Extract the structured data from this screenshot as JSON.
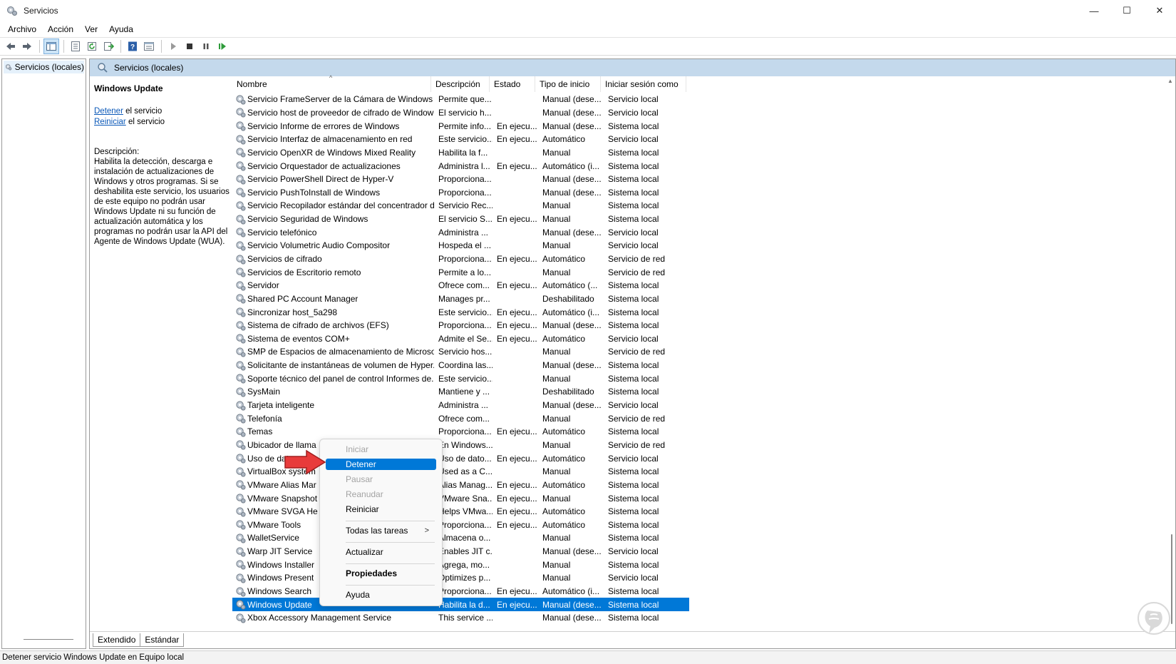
{
  "window": {
    "title": "Servicios",
    "controls": {
      "minimize": "—",
      "maximize": "☐",
      "close": "✕"
    }
  },
  "menubar": [
    "Archivo",
    "Acción",
    "Ver",
    "Ayuda"
  ],
  "toolbar_icons": [
    "back-icon",
    "forward-icon",
    "console-tree-icon",
    "properties-icon",
    "refresh-icon",
    "export-icon",
    "help-icon",
    "view-icon",
    "start-icon",
    "stop-icon",
    "pause-icon",
    "restart-icon"
  ],
  "tree": {
    "item": "Servicios (locales)"
  },
  "pane_header": "Servicios (locales)",
  "detail": {
    "title": "Windows Update",
    "stop_link": "Detener",
    "stop_suffix": " el servicio",
    "restart_link": "Reiniciar",
    "restart_suffix": " el servicio",
    "desc_label": "Descripción:",
    "desc": "Habilita la detección, descarga e instalación de actualizaciones de Windows y otros programas. Si se deshabilita este servicio, los usuarios de este equipo no podrán usar Windows Update ni su función de actualización automática y los programas no podrán usar la API del Agente de Windows Update (WUA)."
  },
  "columns": [
    "Nombre",
    "Descripción",
    "Estado",
    "Tipo de inicio",
    "Iniciar sesión como"
  ],
  "rows": [
    [
      "Servicio FrameServer de la Cámara de Windows",
      "Permite que...",
      "",
      "Manual (dese...",
      "Servicio local"
    ],
    [
      "Servicio host de proveedor de cifrado de Windows",
      "El servicio h...",
      "",
      "Manual (dese...",
      "Servicio local"
    ],
    [
      "Servicio Informe de errores de Windows",
      "Permite info...",
      "En ejecu...",
      "Manual (dese...",
      "Sistema local"
    ],
    [
      "Servicio Interfaz de almacenamiento en red",
      "Este servicio...",
      "En ejecu...",
      "Automático",
      "Servicio local"
    ],
    [
      "Servicio OpenXR de Windows Mixed Reality",
      "Habilita la f...",
      "",
      "Manual",
      "Sistema local"
    ],
    [
      "Servicio Orquestador de actualizaciones",
      "Administra l...",
      "En ejecu...",
      "Automático (i...",
      "Sistema local"
    ],
    [
      "Servicio PowerShell Direct de Hyper-V",
      "Proporciona...",
      "",
      "Manual (dese...",
      "Sistema local"
    ],
    [
      "Servicio PushToInstall de Windows",
      "Proporciona...",
      "",
      "Manual (dese...",
      "Sistema local"
    ],
    [
      "Servicio Recopilador estándar del concentrador d...",
      "Servicio Rec...",
      "",
      "Manual",
      "Sistema local"
    ],
    [
      "Servicio Seguridad de Windows",
      "El servicio S...",
      "En ejecu...",
      "Manual",
      "Sistema local"
    ],
    [
      "Servicio telefónico",
      "Administra ...",
      "",
      "Manual (dese...",
      "Servicio local"
    ],
    [
      "Servicio Volumetric Audio Compositor",
      "Hospeda el ...",
      "",
      "Manual",
      "Servicio local"
    ],
    [
      "Servicios de cifrado",
      "Proporciona...",
      "En ejecu...",
      "Automático",
      "Servicio de red"
    ],
    [
      "Servicios de Escritorio remoto",
      "Permite a lo...",
      "",
      "Manual",
      "Servicio de red"
    ],
    [
      "Servidor",
      "Ofrece com...",
      "En ejecu...",
      "Automático (...",
      "Sistema local"
    ],
    [
      "Shared PC Account Manager",
      "Manages pr...",
      "",
      "Deshabilitado",
      "Sistema local"
    ],
    [
      "Sincronizar host_5a298",
      "Este servicio...",
      "En ejecu...",
      "Automático (i...",
      "Sistema local"
    ],
    [
      "Sistema de cifrado de archivos (EFS)",
      "Proporciona...",
      "En ejecu...",
      "Manual (dese...",
      "Sistema local"
    ],
    [
      "Sistema de eventos COM+",
      "Admite el Se...",
      "En ejecu...",
      "Automático",
      "Servicio local"
    ],
    [
      "SMP de Espacios de almacenamiento de Microsoft",
      "Servicio hos...",
      "",
      "Manual",
      "Servicio de red"
    ],
    [
      "Solicitante de instantáneas de volumen de Hyper...",
      "Coordina las...",
      "",
      "Manual (dese...",
      "Sistema local"
    ],
    [
      "Soporte técnico del panel de control Informes de...",
      "Este servicio...",
      "",
      "Manual",
      "Sistema local"
    ],
    [
      "SysMain",
      "Mantiene y ...",
      "",
      "Deshabilitado",
      "Sistema local"
    ],
    [
      "Tarjeta inteligente",
      "Administra ...",
      "",
      "Manual (dese...",
      "Servicio local"
    ],
    [
      "Telefonía",
      "Ofrece com...",
      "",
      "Manual",
      "Servicio de red"
    ],
    [
      "Temas",
      "Proporciona...",
      "En ejecu...",
      "Automático",
      "Sistema local"
    ],
    [
      "Ubicador de llama",
      "En Windows...",
      "",
      "Manual",
      "Servicio de red"
    ],
    [
      "Uso de datos",
      "Uso de dato...",
      "En ejecu...",
      "Automático",
      "Servicio local"
    ],
    [
      "VirtualBox system",
      "Used as a C...",
      "",
      "Manual",
      "Sistema local"
    ],
    [
      "VMware Alias Mar",
      "Alias Manag...",
      "En ejecu...",
      "Automático",
      "Sistema local"
    ],
    [
      "VMware Snapshot",
      "VMware Sna...",
      "En ejecu...",
      "Manual",
      "Sistema local"
    ],
    [
      "VMware SVGA He",
      "Helps VMwa...",
      "En ejecu...",
      "Automático",
      "Sistema local"
    ],
    [
      "VMware Tools",
      "Proporciona...",
      "En ejecu...",
      "Automático",
      "Sistema local"
    ],
    [
      "WalletService",
      "Almacena o...",
      "",
      "Manual",
      "Sistema local"
    ],
    [
      "Warp JIT Service",
      "Enables JIT c...",
      "",
      "Manual (dese...",
      "Servicio local"
    ],
    [
      "Windows Installer",
      "Agrega, mo...",
      "",
      "Manual",
      "Sistema local"
    ],
    [
      "Windows Present",
      "Optimizes p...",
      "",
      "Manual",
      "Servicio local"
    ],
    [
      "Windows Search",
      "Proporciona...",
      "En ejecu...",
      "Automático (i...",
      "Sistema local"
    ],
    [
      "Windows Update",
      "Habilita la d...",
      "En ejecu...",
      "Manual (dese...",
      "Sistema local"
    ],
    [
      "Xbox Accessory Management Service",
      "This service ...",
      "",
      "Manual (dese...",
      "Sistema local"
    ]
  ],
  "selected_row": 38,
  "tabs": [
    "Extendido",
    "Estándar"
  ],
  "context_menu": {
    "items": [
      "Iniciar",
      "Detener",
      "Pausar",
      "Reanudar",
      "Reiniciar",
      "Todas las tareas",
      "Actualizar",
      "Propiedades",
      "Ayuda"
    ],
    "submenu_arrow": ">"
  },
  "status": "Detener servicio Windows Update en Equipo local",
  "colors": {
    "selection": "#0078d7",
    "pane_header": "#c4d9ec",
    "link": "#0a58b8"
  }
}
